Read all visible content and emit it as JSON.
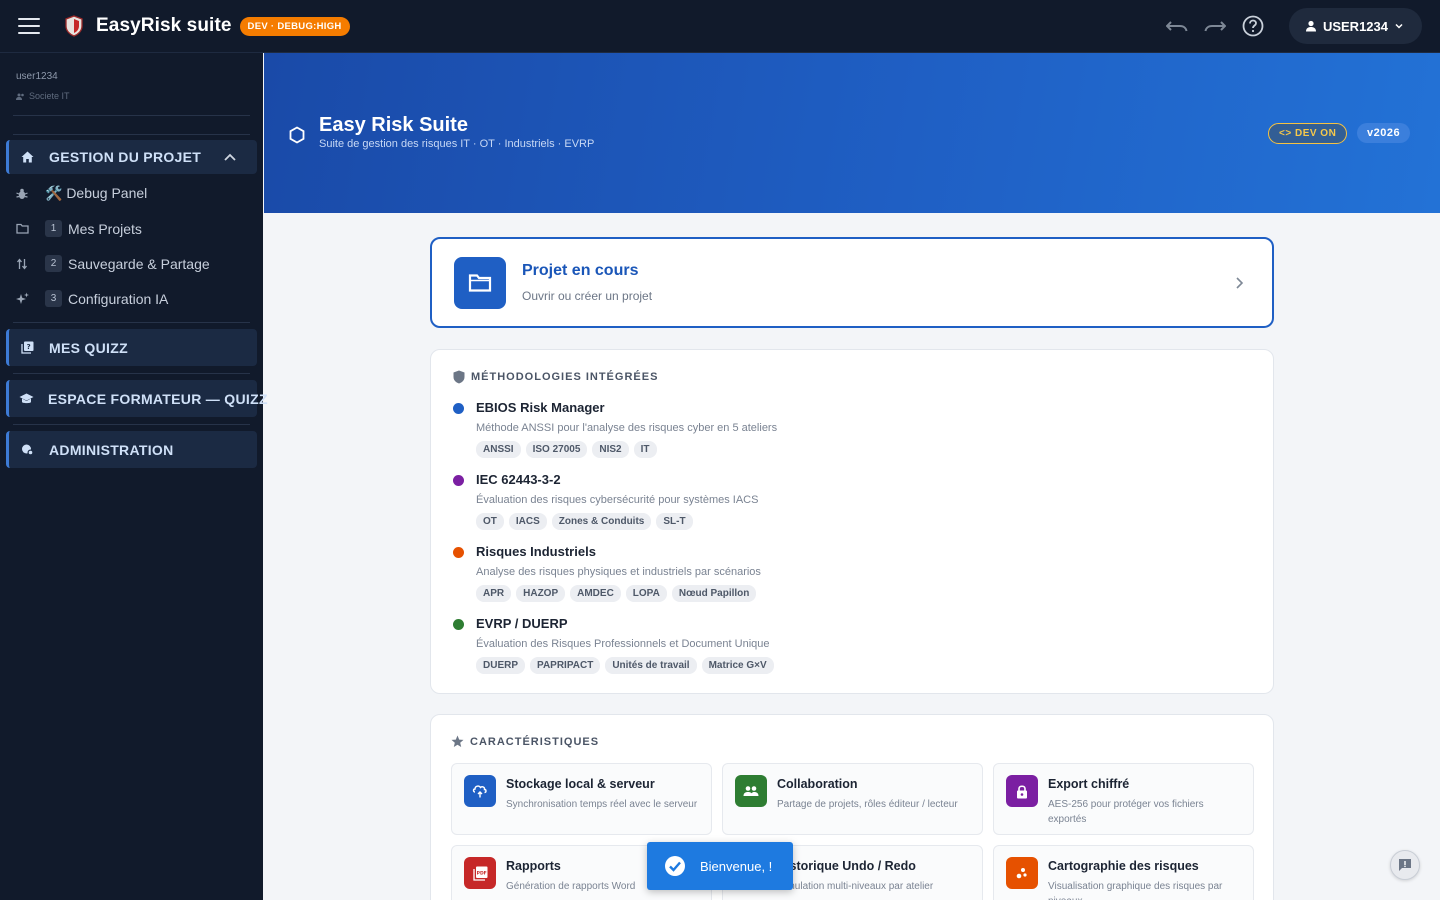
{
  "header": {
    "app_title": "EasyRisk suite",
    "env_badge": "DEV · DEBUG:HIGH",
    "user_label": "USER1234"
  },
  "sidebar": {
    "username": "user1234",
    "role": "Societe IT",
    "sections": [
      {
        "label": "GESTION DU PROJET",
        "expanded": true
      },
      {
        "label": "MES QUIZZ"
      },
      {
        "label": "ESPACE FORMATEUR — QUIZZ"
      },
      {
        "label": "ADMINISTRATION"
      }
    ],
    "items": [
      {
        "label": "🛠️ Debug Panel",
        "icon": "bug-icon"
      },
      {
        "num": "1",
        "label": "Mes Projets",
        "icon": "folder-icon"
      },
      {
        "num": "2",
        "label": "Sauvegarde & Partage",
        "icon": "swap-icon"
      },
      {
        "num": "3",
        "label": "Configuration IA",
        "icon": "sparkle-icon"
      }
    ]
  },
  "hero": {
    "title": "Easy Risk Suite",
    "subtitle": "Suite de gestion des risques IT · OT · Industriels · EVRP",
    "dev_badge": "DEV ON",
    "version": "v2026"
  },
  "project": {
    "title": "Projet en cours",
    "subtitle": "Ouvrir ou créer un projet"
  },
  "methodologies": {
    "heading": "MÉTHODOLOGIES INTÉGRÉES",
    "items": [
      {
        "title": "EBIOS Risk Manager",
        "desc": "Méthode ANSSI pour l'analyse des risques cyber en 5 ateliers",
        "color": "#1f5fc4",
        "tags": [
          "ANSSI",
          "ISO 27005",
          "NIS2",
          "IT"
        ]
      },
      {
        "title": "IEC 62443-3-2",
        "desc": "Évaluation des risques cybersécurité pour systèmes IACS",
        "color": "#7b1fa2",
        "tags": [
          "OT",
          "IACS",
          "Zones & Conduits",
          "SL-T"
        ]
      },
      {
        "title": "Risques Industriels",
        "desc": "Analyse des risques physiques et industriels par scénarios",
        "color": "#e65100",
        "tags": [
          "APR",
          "HAZOP",
          "AMDEC",
          "LOPA",
          "Nœud Papillon"
        ]
      },
      {
        "title": "EVRP / DUERP",
        "desc": "Évaluation des Risques Professionnels et Document Unique",
        "color": "#2e7d32",
        "tags": [
          "DUERP",
          "PAPRIPACT",
          "Unités de travail",
          "Matrice G×V"
        ]
      }
    ]
  },
  "features": {
    "heading": "CARACTÉRISTIQUES",
    "items": [
      {
        "title": "Stockage local & serveur",
        "desc": "Synchronisation temps réel avec le serveur",
        "color": "#1f5fc4",
        "icon": "cloud-sync-icon"
      },
      {
        "title": "Collaboration",
        "desc": "Partage de projets, rôles éditeur / lecteur",
        "color": "#2e7d32",
        "icon": "group-icon"
      },
      {
        "title": "Export chiffré",
        "desc": "AES-256 pour protéger vos fichiers exportés",
        "color": "#7b1fa2",
        "icon": "lock-icon"
      },
      {
        "title": "Rapports",
        "desc": "Génération de rapports Word",
        "color": "#c62828",
        "icon": "pdf-icon"
      },
      {
        "title": "Historique Undo / Redo",
        "desc": "Annulation multi-niveaux par atelier",
        "color": "#00838f",
        "icon": "history-icon"
      },
      {
        "title": "Cartographie des risques",
        "desc": "Visualisation graphique des risques par niveaux",
        "color": "#e65100",
        "icon": "map-icon"
      }
    ]
  },
  "toast": {
    "text": "Bienvenue, !"
  }
}
